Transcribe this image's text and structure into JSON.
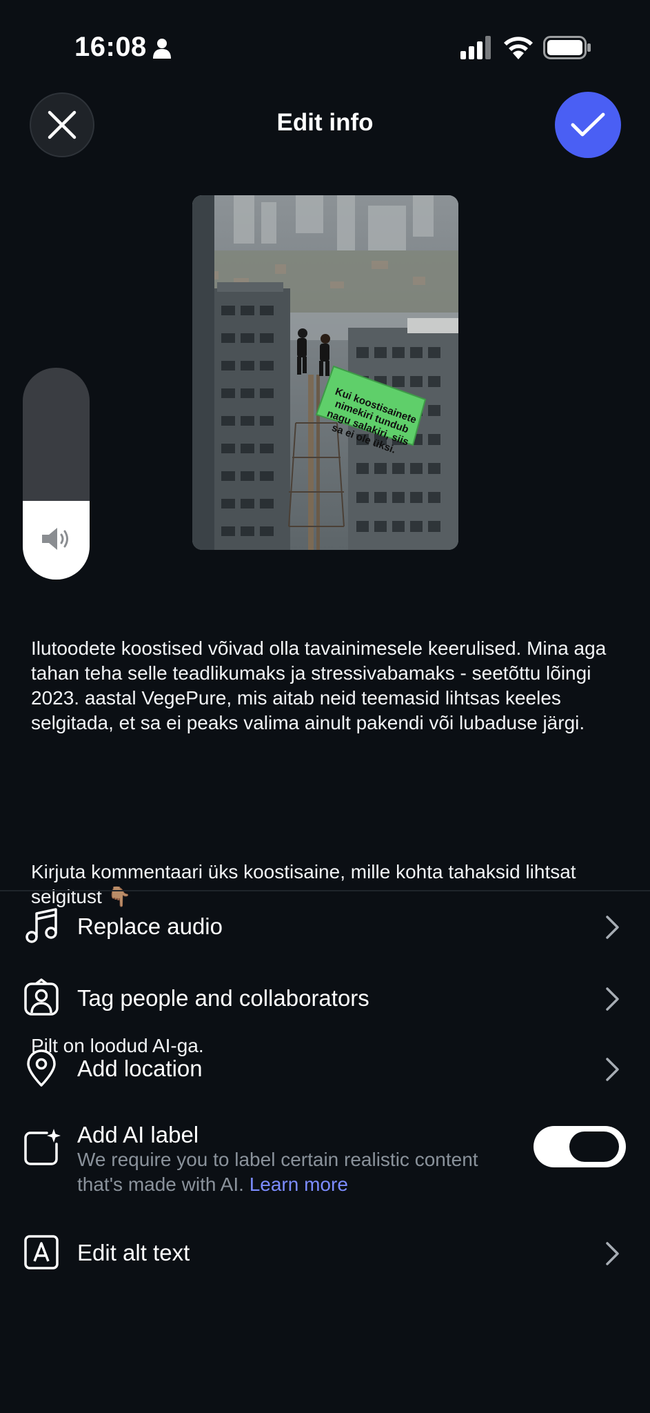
{
  "status_bar": {
    "time": "16:08"
  },
  "header": {
    "title": "Edit info"
  },
  "media": {
    "flag_text": "Kui koostisainete nimekiri tundub nagu salakiri, siis sa ei ole üksi."
  },
  "caption": {
    "paragraph1": "Ilutoodete koostised võivad olla tavainimesele keerulised. Mina aga tahan teha selle teadlikumaks ja stressivabamaks - seetõttu lõingi 2023. aastal VegePure, mis aitab neid teemasid lihtsas keeles selgitada, et sa ei peaks valima ainult pakendi või lubaduse järgi.",
    "paragraph2": "Kirjuta kommentaari üks koostisaine, mille kohta tahaksid lihtsat selgitust 👇🏽",
    "paragraph3": "Pilt on loodud AI-ga."
  },
  "menu": {
    "replace_audio": "Replace audio",
    "tag_people": "Tag people and collaborators",
    "add_location": "Add location",
    "add_ai_label": "Add AI label",
    "ai_label_desc": "We require you to label certain realistic content that's made with AI.",
    "ai_label_link": "Learn more",
    "edit_alt_text": "Edit alt text"
  },
  "toggles": {
    "ai_label_on": true
  },
  "volume_level": 0.37,
  "colors": {
    "background": "#0b0f14",
    "accent": "#4a5ff4",
    "link": "#7c8cff",
    "flag_green": "#5fcf6a"
  }
}
